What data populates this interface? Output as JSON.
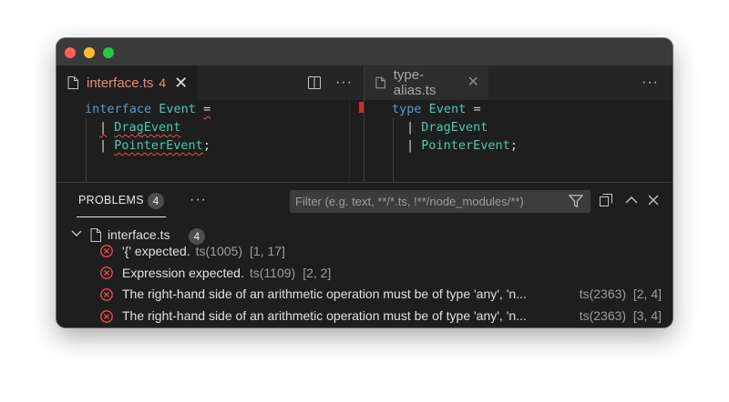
{
  "editor": {
    "left": {
      "tab": {
        "label": "interface.ts",
        "count": "4",
        "close": "✕"
      },
      "code": {
        "line1": {
          "keyword": "interface",
          "name": "Event",
          "op": "="
        },
        "line2": {
          "pipe": "|",
          "type": "DragEvent"
        },
        "line3": {
          "pipe": "|",
          "type": "PointerEvent",
          "end": ";"
        }
      }
    },
    "right": {
      "tab": {
        "label": "type-alias.ts",
        "close": "✕"
      },
      "code": {
        "line1": {
          "keyword": "type",
          "name": "Event",
          "op": "="
        },
        "line2": {
          "pipe": "|",
          "type": "DragEvent"
        },
        "line3": {
          "pipe": "|",
          "type": "PointerEvent",
          "end": ";"
        }
      }
    },
    "more_label": "···"
  },
  "panel": {
    "tab_label": "PROBLEMS",
    "tab_count": "4",
    "more_label": "···",
    "filter_placeholder": "Filter (e.g. text, **/*.ts, !**/node_modules/**)",
    "file": {
      "label": "interface.ts",
      "count": "4"
    },
    "problems": [
      {
        "message": "'{' expected.",
        "code": "ts(1005)",
        "position": "[1, 17]"
      },
      {
        "message": "Expression expected.",
        "code": "ts(1109)",
        "position": "[2, 2]"
      },
      {
        "message": "The right-hand side of an arithmetic operation must be of type 'any', 'n...",
        "code": "ts(2363)",
        "position": "[2, 4]"
      },
      {
        "message": "The right-hand side of an arithmetic operation must be of type 'any', 'n...",
        "code": "ts(2363)",
        "position": "[3, 4]"
      }
    ]
  },
  "colors": {
    "error": "#f14c4c",
    "keyword": "#569cd6",
    "type": "#4ec9b0",
    "tab_error_label": "#f48771"
  },
  "icons": [
    "file-icon",
    "split-editor-icon",
    "more-icon",
    "close-icon",
    "chevron-down-icon",
    "filter-icon",
    "collapse-all-icon",
    "maximize-panel-icon",
    "close-panel-icon",
    "error-icon"
  ]
}
